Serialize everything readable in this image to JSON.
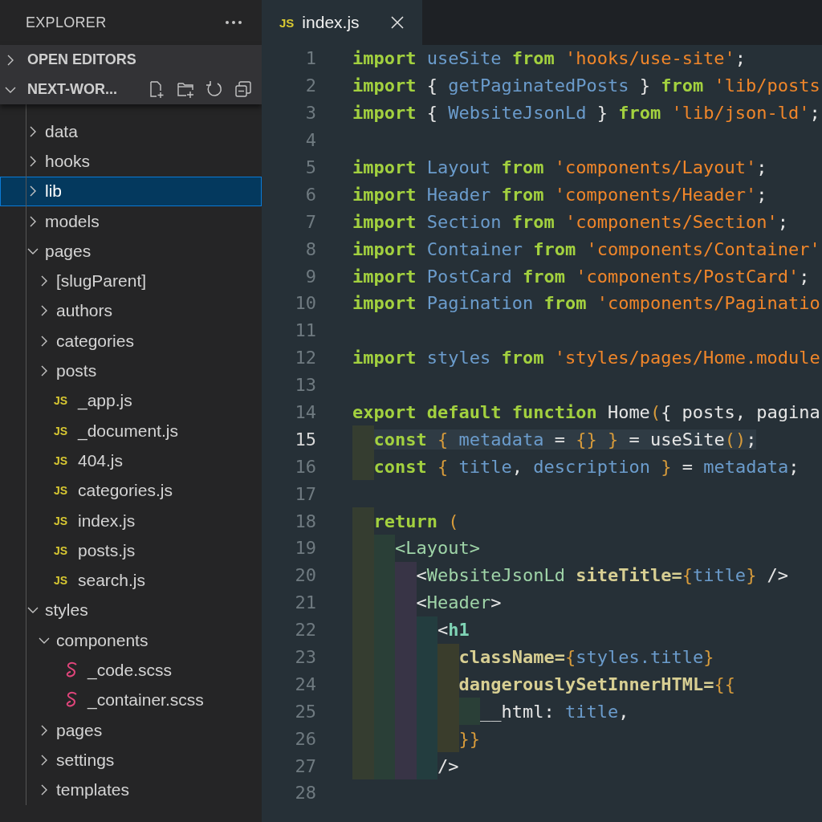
{
  "sidebar": {
    "title": "EXPLORER",
    "sections": [
      {
        "label": "OPEN EDITORS",
        "expanded": false
      },
      {
        "label": "NEXT-WOR...",
        "expanded": true
      }
    ],
    "tree": [
      {
        "kind": "folder",
        "label": "data",
        "expanded": false,
        "selected": false
      },
      {
        "kind": "folder",
        "label": "hooks",
        "expanded": false,
        "selected": false
      },
      {
        "kind": "folder",
        "label": "lib",
        "expanded": false,
        "selected": true
      },
      {
        "kind": "folder",
        "label": "models",
        "expanded": false,
        "selected": false
      },
      {
        "kind": "folder",
        "label": "pages",
        "expanded": true,
        "selected": false,
        "children": [
          {
            "kind": "folder",
            "label": "[slugParent]",
            "expanded": false,
            "selected": false
          },
          {
            "kind": "folder",
            "label": "authors",
            "expanded": false,
            "selected": false
          },
          {
            "kind": "folder",
            "label": "categories",
            "expanded": false,
            "selected": false
          },
          {
            "kind": "folder",
            "label": "posts",
            "expanded": false,
            "selected": false
          },
          {
            "kind": "js",
            "badge": "JS",
            "label": "_app.js",
            "selected": false
          },
          {
            "kind": "js",
            "badge": "JS",
            "label": "_document.js",
            "selected": false
          },
          {
            "kind": "js",
            "badge": "JS",
            "label": "404.js",
            "selected": false
          },
          {
            "kind": "js",
            "badge": "JS",
            "label": "categories.js",
            "selected": false
          },
          {
            "kind": "js",
            "badge": "JS",
            "label": "index.js",
            "selected": false
          },
          {
            "kind": "js",
            "badge": "JS",
            "label": "posts.js",
            "selected": false
          },
          {
            "kind": "js",
            "badge": "JS",
            "label": "search.js",
            "selected": false
          }
        ]
      },
      {
        "kind": "folder",
        "label": "styles",
        "expanded": true,
        "selected": false,
        "children": [
          {
            "kind": "folder",
            "label": "components",
            "expanded": true,
            "selected": false,
            "children": [
              {
                "kind": "scss",
                "label": "_code.scss",
                "selected": false
              },
              {
                "kind": "scss",
                "label": "_container.scss",
                "selected": false
              }
            ]
          },
          {
            "kind": "folder",
            "label": "pages",
            "expanded": false,
            "selected": false
          },
          {
            "kind": "folder",
            "label": "settings",
            "expanded": false,
            "selected": false
          },
          {
            "kind": "folder",
            "label": "templates",
            "expanded": false,
            "selected": false
          }
        ]
      }
    ]
  },
  "editor": {
    "tab": {
      "badge": "JS",
      "label": "index.js"
    },
    "lines": [
      {
        "number": "1",
        "current": false,
        "tokens": [
          {
            "kind": "kw",
            "text": "import"
          },
          {
            "kind": "id",
            "text": " useSite "
          },
          {
            "kind": "kw",
            "text": "from"
          },
          {
            "kind": "str",
            "text": " 'hooks/use-site'"
          },
          {
            "kind": "plain",
            "text": ";"
          }
        ]
      },
      {
        "number": "2",
        "current": false,
        "tokens": [
          {
            "kind": "kw",
            "text": "import"
          },
          {
            "kind": "plain",
            "text": " { "
          },
          {
            "kind": "id",
            "text": "getPaginatedPosts"
          },
          {
            "kind": "plain",
            "text": " } "
          },
          {
            "kind": "kw",
            "text": "from"
          },
          {
            "kind": "str",
            "text": " 'lib/posts"
          }
        ]
      },
      {
        "number": "3",
        "current": false,
        "tokens": [
          {
            "kind": "kw",
            "text": "import"
          },
          {
            "kind": "plain",
            "text": " { "
          },
          {
            "kind": "id",
            "text": "WebsiteJsonLd"
          },
          {
            "kind": "plain",
            "text": " } "
          },
          {
            "kind": "kw",
            "text": "from"
          },
          {
            "kind": "str",
            "text": " 'lib/json-ld'"
          },
          {
            "kind": "plain",
            "text": ";"
          }
        ]
      },
      {
        "number": "4",
        "current": false
      },
      {
        "number": "5",
        "current": false,
        "tokens": [
          {
            "kind": "kw",
            "text": "import"
          },
          {
            "kind": "id",
            "text": " Layout "
          },
          {
            "kind": "kw",
            "text": "from"
          },
          {
            "kind": "str",
            "text": " 'components/Layout'"
          },
          {
            "kind": "plain",
            "text": ";"
          }
        ]
      },
      {
        "number": "6",
        "current": false,
        "tokens": [
          {
            "kind": "kw",
            "text": "import"
          },
          {
            "kind": "id",
            "text": " Header "
          },
          {
            "kind": "kw",
            "text": "from"
          },
          {
            "kind": "str",
            "text": " 'components/Header'"
          },
          {
            "kind": "plain",
            "text": ";"
          }
        ]
      },
      {
        "number": "7",
        "current": false,
        "tokens": [
          {
            "kind": "kw",
            "text": "import"
          },
          {
            "kind": "id",
            "text": " Section "
          },
          {
            "kind": "kw",
            "text": "from"
          },
          {
            "kind": "str",
            "text": " 'components/Section'"
          },
          {
            "kind": "plain",
            "text": ";"
          }
        ]
      },
      {
        "number": "8",
        "current": false,
        "tokens": [
          {
            "kind": "kw",
            "text": "import"
          },
          {
            "kind": "id",
            "text": " Container "
          },
          {
            "kind": "kw",
            "text": "from"
          },
          {
            "kind": "str",
            "text": " 'components/Container'"
          }
        ]
      },
      {
        "number": "9",
        "current": false,
        "tokens": [
          {
            "kind": "kw",
            "text": "import"
          },
          {
            "kind": "id",
            "text": " PostCard "
          },
          {
            "kind": "kw",
            "text": "from"
          },
          {
            "kind": "str",
            "text": " 'components/PostCard'"
          },
          {
            "kind": "plain",
            "text": ";"
          }
        ]
      },
      {
        "number": "10",
        "current": false,
        "tokens": [
          {
            "kind": "kw",
            "text": "import"
          },
          {
            "kind": "id",
            "text": " Pagination "
          },
          {
            "kind": "kw",
            "text": "from"
          },
          {
            "kind": "str",
            "text": " 'components/Paginatio"
          }
        ]
      },
      {
        "number": "11",
        "current": false
      },
      {
        "number": "12",
        "current": false,
        "tokens": [
          {
            "kind": "kw",
            "text": "import"
          },
          {
            "kind": "id",
            "text": " styles "
          },
          {
            "kind": "kw",
            "text": "from"
          },
          {
            "kind": "str",
            "text": " 'styles/pages/Home.module"
          }
        ]
      },
      {
        "number": "13",
        "current": false
      },
      {
        "number": "14",
        "current": false,
        "tokens": [
          {
            "kind": "kw",
            "text": "export default function"
          },
          {
            "kind": "plain",
            "text": " Home"
          },
          {
            "kind": "brace",
            "text": "("
          },
          {
            "kind": "plain",
            "text": "{ posts, pagina"
          }
        ]
      },
      {
        "number": "15",
        "current": true,
        "tokens": [
          {
            "kind": "kw",
            "text": "  const"
          },
          {
            "kind": "brace",
            "text": " { "
          },
          {
            "kind": "id",
            "text": "metadata"
          },
          {
            "kind": "plain",
            "text": " = "
          },
          {
            "kind": "brace",
            "text": "{} }"
          },
          {
            "kind": "plain",
            "text": " = useSite"
          },
          {
            "kind": "brace",
            "text": "()"
          },
          {
            "kind": "plain",
            "text": ";"
          }
        ]
      },
      {
        "number": "16",
        "current": false,
        "tokens": [
          {
            "kind": "kw",
            "text": "  const"
          },
          {
            "kind": "brace",
            "text": " { "
          },
          {
            "kind": "id",
            "text": "title"
          },
          {
            "kind": "plain",
            "text": ", "
          },
          {
            "kind": "id",
            "text": "description"
          },
          {
            "kind": "brace",
            "text": " } "
          },
          {
            "kind": "plain",
            "text": "= "
          },
          {
            "kind": "id",
            "text": "metadata"
          },
          {
            "kind": "plain",
            "text": ";"
          }
        ]
      },
      {
        "number": "17",
        "current": false
      },
      {
        "number": "18",
        "current": false,
        "tokens": [
          {
            "kind": "kw",
            "text": "  return"
          },
          {
            "kind": "brace",
            "text": " ("
          }
        ]
      },
      {
        "number": "19",
        "current": false,
        "tokens": [
          {
            "kind": "tag",
            "text": "    <Layout>"
          }
        ]
      },
      {
        "number": "20",
        "current": false,
        "tokens": [
          {
            "kind": "plain",
            "text": "      <"
          },
          {
            "kind": "tag",
            "text": "WebsiteJsonLd"
          },
          {
            "kind": "attr",
            "text": " siteTitle="
          },
          {
            "kind": "brace",
            "text": "{"
          },
          {
            "kind": "id",
            "text": "title"
          },
          {
            "kind": "brace",
            "text": "}"
          },
          {
            "kind": "plain",
            "text": " />"
          }
        ]
      },
      {
        "number": "21",
        "current": false,
        "tokens": [
          {
            "kind": "plain",
            "text": "      <"
          },
          {
            "kind": "tag",
            "text": "Header"
          },
          {
            "kind": "plain",
            "text": ">"
          }
        ]
      },
      {
        "number": "22",
        "current": false,
        "tokens": [
          {
            "kind": "plain",
            "text": "        <"
          },
          {
            "kind": "el",
            "text": "h1"
          }
        ]
      },
      {
        "number": "23",
        "current": false,
        "tokens": [
          {
            "kind": "attr",
            "text": "          className="
          },
          {
            "kind": "brace",
            "text": "{"
          },
          {
            "kind": "id",
            "text": "styles.title"
          },
          {
            "kind": "brace",
            "text": "}"
          }
        ]
      },
      {
        "number": "24",
        "current": false,
        "tokens": [
          {
            "kind": "attr",
            "text": "          dangerouslySetInnerHTML="
          },
          {
            "kind": "brace",
            "text": "{{"
          }
        ]
      },
      {
        "number": "25",
        "current": false,
        "tokens": [
          {
            "kind": "plain",
            "text": "            __html: "
          },
          {
            "kind": "id",
            "text": "title"
          },
          {
            "kind": "plain",
            "text": ","
          }
        ]
      },
      {
        "number": "26",
        "current": false,
        "tokens": [
          {
            "kind": "brace",
            "text": "          }}"
          }
        ]
      },
      {
        "number": "27",
        "current": false,
        "tokens": [
          {
            "kind": "plain",
            "text": "        />"
          }
        ]
      },
      {
        "number": "28",
        "current": false
      }
    ]
  }
}
